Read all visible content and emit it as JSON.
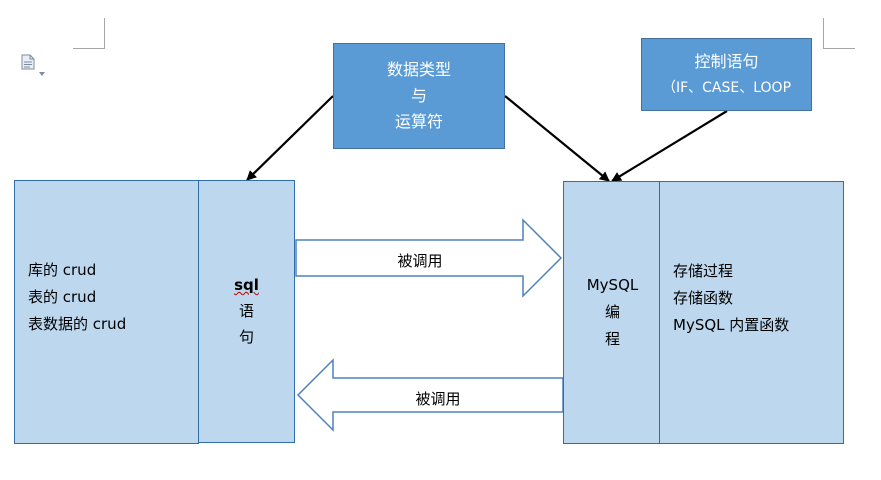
{
  "top_boxes": {
    "types": {
      "line1": "数据类型",
      "line2": "与",
      "line3": "运算符"
    },
    "control": {
      "line1": "控制语句",
      "line2": "（IF、CASE、LOOP"
    }
  },
  "left_box": {
    "items": [
      "库的 crud",
      "表的 crud",
      "表数据的 crud"
    ]
  },
  "sql_box": {
    "line1": "sql",
    "line2": "语",
    "line3": "句"
  },
  "mysql_box": {
    "line1": "MySQL",
    "line2": "编",
    "line3": "程"
  },
  "right_box": {
    "items": [
      "存储过程",
      "存储函数",
      "MySQL 内置函数"
    ]
  },
  "arrows": {
    "forward_label": "被调用",
    "backward_label": "被调用"
  },
  "colors": {
    "light_fill": "#bdd7ee",
    "dark_fill": "#5b9bd5",
    "border": "#2f6ea8"
  },
  "icons": {
    "doc": "document-icon",
    "dropdown": "dropdown-caret-icon"
  }
}
